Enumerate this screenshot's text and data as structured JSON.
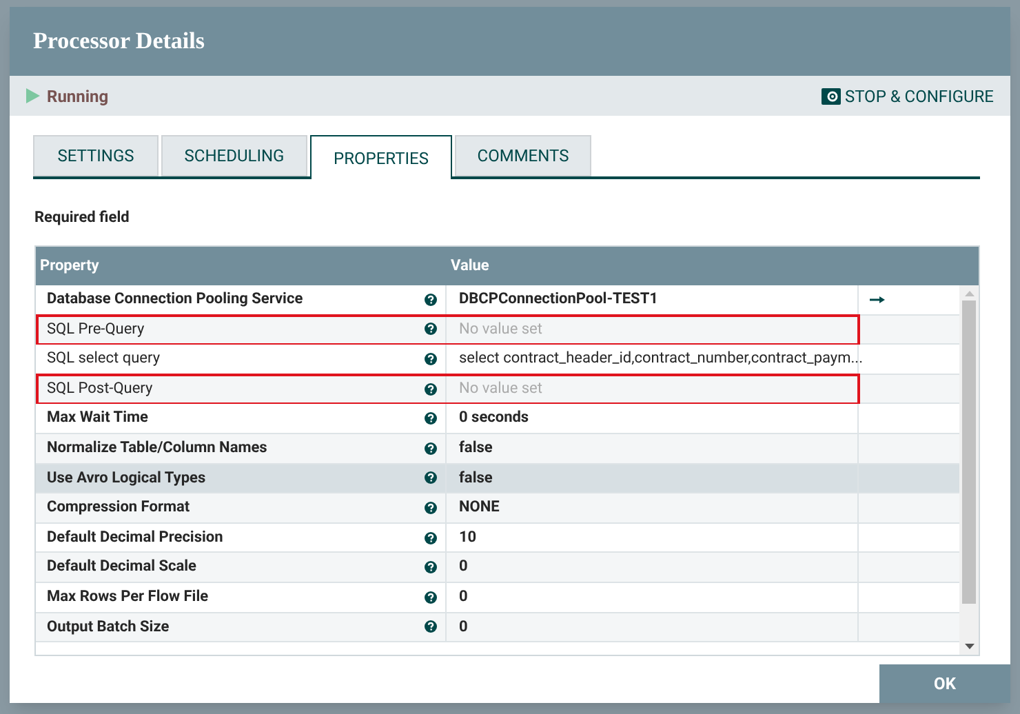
{
  "dialog": {
    "title": "Processor Details"
  },
  "status": {
    "label": "Running",
    "action": "STOP & CONFIGURE"
  },
  "tabs": [
    {
      "label": "SETTINGS",
      "selected": false
    },
    {
      "label": "SCHEDULING",
      "selected": false
    },
    {
      "label": "PROPERTIES",
      "selected": true
    },
    {
      "label": "COMMENTS",
      "selected": false
    }
  ],
  "required_note": "Required field",
  "table": {
    "columns": [
      "Property",
      "Value"
    ],
    "rows": [
      {
        "property": "Database Connection Pooling Service",
        "required": true,
        "value": "DBCPConnectionPool-TEST1",
        "value_set": true,
        "highlighted": false,
        "selected": false,
        "goto": true
      },
      {
        "property": "SQL Pre-Query",
        "required": false,
        "value": "No value set",
        "value_set": false,
        "highlighted": true,
        "selected": false,
        "goto": false
      },
      {
        "property": "SQL select query",
        "required": false,
        "value": "select contract_header_id,contract_number,contract_paym...",
        "value_set": true,
        "highlighted": false,
        "selected": false,
        "goto": false
      },
      {
        "property": "SQL Post-Query",
        "required": false,
        "value": "No value set",
        "value_set": false,
        "highlighted": true,
        "selected": false,
        "goto": false
      },
      {
        "property": "Max Wait Time",
        "required": true,
        "value": "0 seconds",
        "value_set": true,
        "highlighted": false,
        "selected": false,
        "goto": false
      },
      {
        "property": "Normalize Table/Column Names",
        "required": true,
        "value": "false",
        "value_set": true,
        "highlighted": false,
        "selected": false,
        "goto": false
      },
      {
        "property": "Use Avro Logical Types",
        "required": true,
        "value": "false",
        "value_set": true,
        "highlighted": false,
        "selected": true,
        "goto": false
      },
      {
        "property": "Compression Format",
        "required": true,
        "value": "NONE",
        "value_set": true,
        "highlighted": false,
        "selected": false,
        "goto": false
      },
      {
        "property": "Default Decimal Precision",
        "required": true,
        "value": "10",
        "value_set": true,
        "highlighted": false,
        "selected": false,
        "goto": false
      },
      {
        "property": "Default Decimal Scale",
        "required": true,
        "value": "0",
        "value_set": true,
        "highlighted": false,
        "selected": false,
        "goto": false
      },
      {
        "property": "Max Rows Per Flow File",
        "required": true,
        "value": "0",
        "value_set": true,
        "highlighted": false,
        "selected": false,
        "goto": false
      },
      {
        "property": "Output Batch Size",
        "required": true,
        "value": "0",
        "value_set": true,
        "highlighted": false,
        "selected": false,
        "goto": false
      }
    ]
  },
  "buttons": [
    "OK"
  ]
}
